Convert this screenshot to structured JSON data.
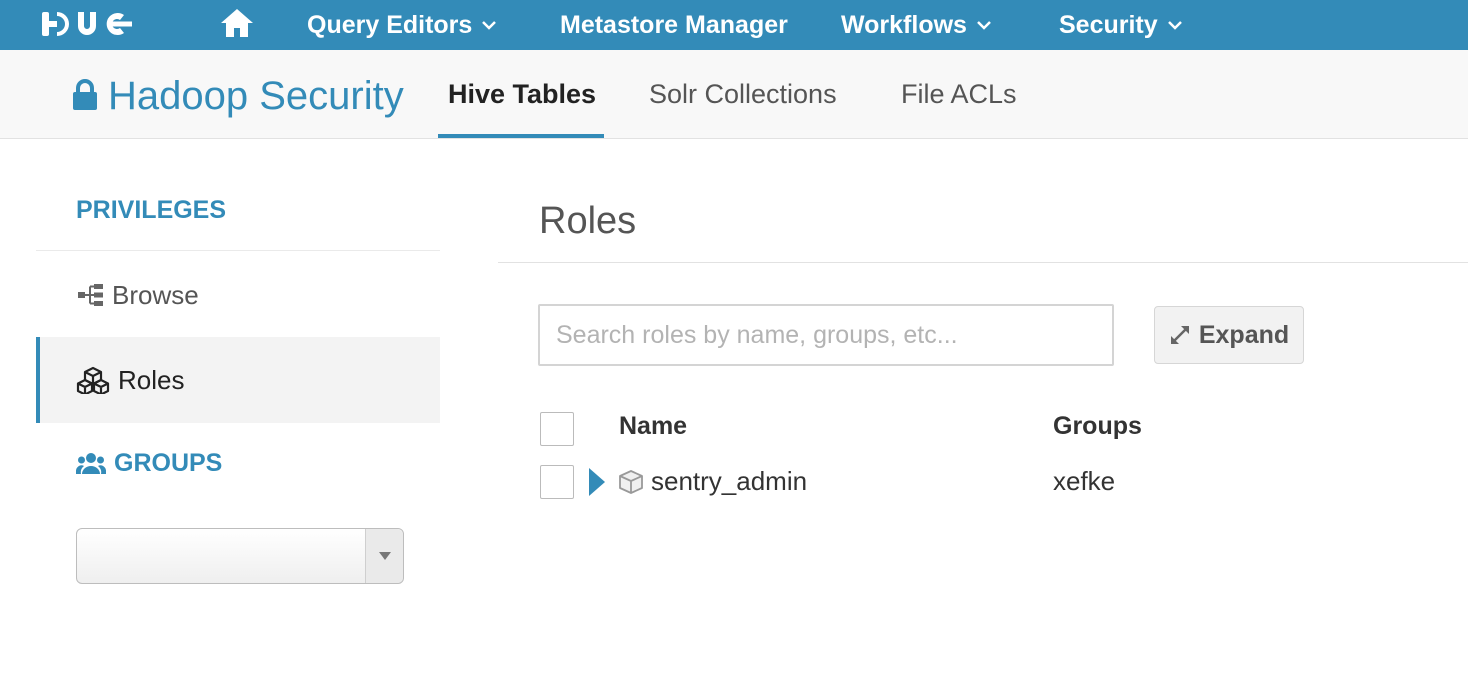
{
  "topnav": {
    "logo": "HUE",
    "home_icon": "home-icon",
    "items": [
      {
        "label": "Query Editors",
        "has_dropdown": true
      },
      {
        "label": "Metastore Manager",
        "has_dropdown": false
      },
      {
        "label": "Workflows",
        "has_dropdown": true
      },
      {
        "label": "Security",
        "has_dropdown": true
      }
    ]
  },
  "app": {
    "title": "Hadoop Security",
    "title_icon": "lock-icon",
    "tabs": [
      {
        "label": "Hive Tables",
        "active": true
      },
      {
        "label": "Solr Collections",
        "active": false
      },
      {
        "label": "File ACLs",
        "active": false
      }
    ]
  },
  "sidebar": {
    "privileges_header": "PRIVILEGES",
    "items": [
      {
        "label": "Browse",
        "icon": "tree-icon",
        "active": false
      },
      {
        "label": "Roles",
        "icon": "cubes-icon",
        "active": true
      }
    ],
    "groups_header": "GROUPS",
    "groups_icon": "users-icon",
    "group_select": {
      "selected": ""
    }
  },
  "main": {
    "title": "Roles",
    "search": {
      "placeholder": "Search roles by name, groups, etc...",
      "value": ""
    },
    "expand_label": "Expand",
    "table": {
      "columns": [
        "Name",
        "Groups"
      ],
      "rows": [
        {
          "name": "sentry_admin",
          "groups": "xefke"
        }
      ]
    }
  },
  "colors": {
    "brand": "#338bb8",
    "nav_bg": "#338bb8",
    "subheader_bg": "#f8f8f8",
    "active_side_bg": "#f3f3f3"
  }
}
